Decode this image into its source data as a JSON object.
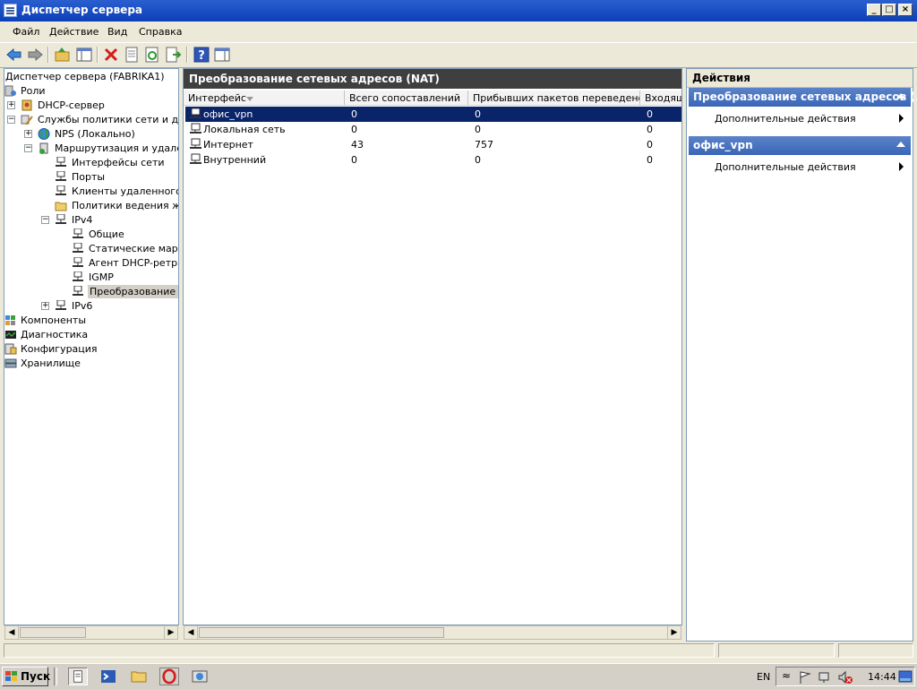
{
  "window": {
    "title": "Диспетчер сервера"
  },
  "menu": [
    "Файл",
    "Действие",
    "Вид",
    "Справка"
  ],
  "tree": {
    "items": [
      {
        "label": "Диспетчер сервера (FABRIKA1)"
      },
      {
        "label": "Роли"
      },
      {
        "label": "DHCP-сервер"
      },
      {
        "label": "Службы политики сети и дост"
      },
      {
        "label": "NPS (Локально)"
      },
      {
        "label": "Маршрутизация и удаленн"
      },
      {
        "label": "Интерфейсы сети"
      },
      {
        "label": "Порты"
      },
      {
        "label": "Клиенты удаленного д"
      },
      {
        "label": "Политики ведения жур"
      },
      {
        "label": "IPv4"
      },
      {
        "label": "Общие"
      },
      {
        "label": "Статические маршр"
      },
      {
        "label": "Агент DHCP-ретран"
      },
      {
        "label": "IGMP"
      },
      {
        "label": "Преобразование се"
      },
      {
        "label": "IPv6"
      },
      {
        "label": "Компоненты"
      },
      {
        "label": "Диагностика"
      },
      {
        "label": "Конфигурация"
      },
      {
        "label": "Хранилище"
      }
    ]
  },
  "main": {
    "title": "Преобразование сетевых адресов (NAT)",
    "columns": [
      "Интерфейс",
      "Всего сопоставлений",
      "Прибывших пакетов переведено",
      "Входящ"
    ],
    "rows": [
      {
        "iface": "офис_vpn",
        "total": "0",
        "in_translated": "0",
        "incoming": "0"
      },
      {
        "iface": "Локальная сеть",
        "total": "0",
        "in_translated": "0",
        "incoming": "0"
      },
      {
        "iface": "Интернет",
        "total": "43",
        "in_translated": "757",
        "incoming": "0"
      },
      {
        "iface": "Внутренний",
        "total": "0",
        "in_translated": "0",
        "incoming": "0"
      }
    ]
  },
  "actions": {
    "title": "Действия",
    "sections": [
      {
        "title": "Преобразование сетевых адресов (...",
        "item": "Дополнительные действия"
      },
      {
        "title": "офис_vpn",
        "item": "Дополнительные действия"
      }
    ]
  },
  "taskbar": {
    "start": "Пуск",
    "lang": "EN",
    "time": "14:44"
  },
  "colors": {
    "selection": "#0a246a",
    "section_bar": "#3a66b8",
    "header_dark": "#3f3f3f"
  }
}
